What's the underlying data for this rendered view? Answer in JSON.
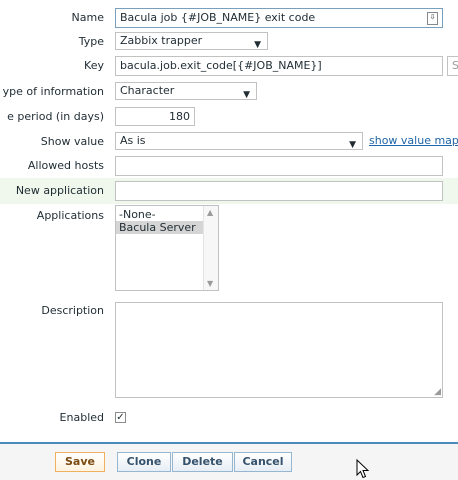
{
  "form": {
    "name": {
      "label": "Name",
      "value": "Bacula job {#JOB_NAME} exit code"
    },
    "type": {
      "label": "Type",
      "value": "Zabbix trapper"
    },
    "key": {
      "label": "Key",
      "value": "bacula.job.exit_code[{#JOB_NAME}]",
      "button": "S"
    },
    "type_of_information": {
      "label": "ype of information",
      "value": "Character"
    },
    "history": {
      "label": "e period (in days)",
      "value": "180"
    },
    "show_value": {
      "label": "Show value",
      "value": "As is",
      "link": "show value map"
    },
    "allowed_hosts": {
      "label": "Allowed hosts",
      "value": ""
    },
    "new_application": {
      "label": "New application",
      "value": ""
    },
    "applications": {
      "label": "Applications",
      "options": [
        "-None-",
        "Bacula Server"
      ],
      "selected": "Bacula Server"
    },
    "description": {
      "label": "Description",
      "value": ""
    },
    "enabled": {
      "label": "Enabled",
      "checked": true,
      "mark": "✓"
    }
  },
  "buttons": {
    "save": "Save",
    "clone": "Clone",
    "delete": "Delete",
    "cancel": "Cancel"
  },
  "colors": {
    "accent": "#4b8bbb",
    "new_application_bg": "#f0f7ec",
    "link": "#1f65a7"
  }
}
